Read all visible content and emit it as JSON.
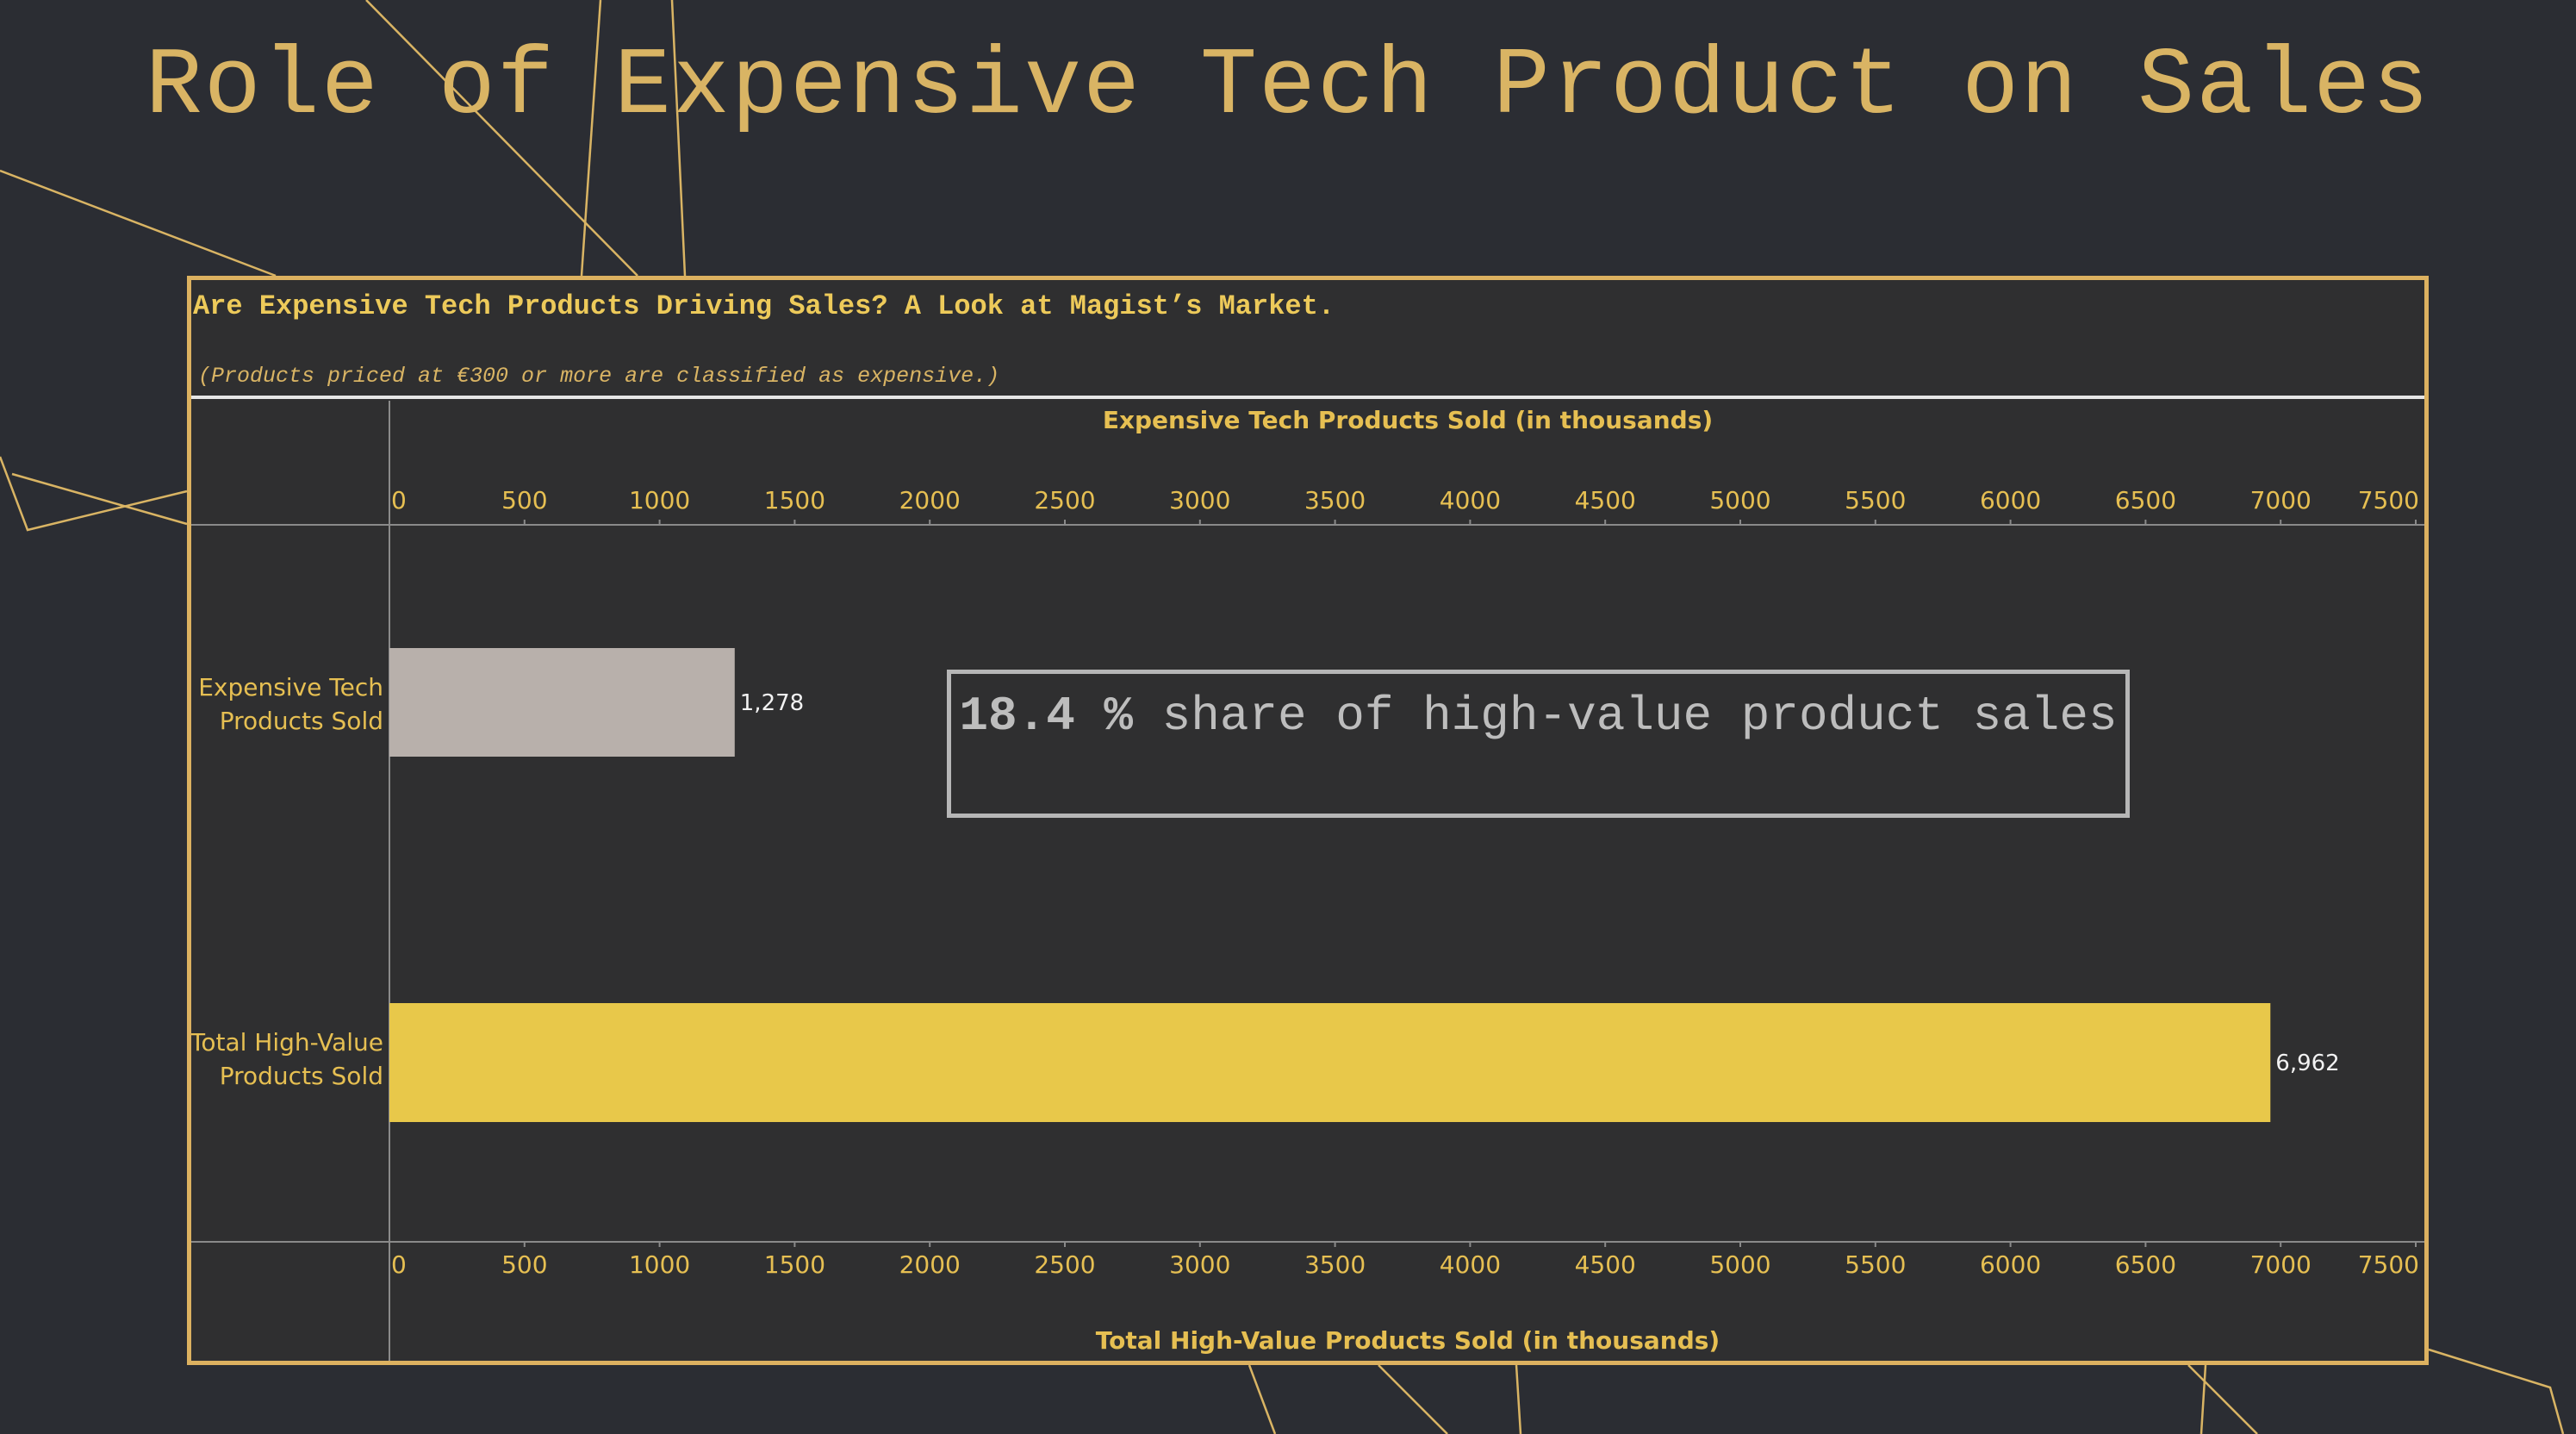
{
  "slide": {
    "title": "Role of Expensive Tech Product on Sales"
  },
  "panel": {
    "heading": "Are Expensive Tech Products Driving Sales? A Look at Magist’s Market.",
    "note": "(Products priced at €300 or more are classified as expensive.)"
  },
  "callout": {
    "value": "18.4 %",
    "text": "share of high-value product sales"
  },
  "colors": {
    "background": "#2b2d33",
    "panel_background": "#2f2f30",
    "accent_gold": "#dcb160",
    "label_gold": "#e6bf52",
    "bar_expensive": "#b8b0ab",
    "bar_total": "#e8c84a"
  },
  "chart_data": {
    "type": "bar",
    "orientation": "horizontal",
    "categories": [
      "Expensive Tech Products Sold",
      "Total High-Value Products Sold"
    ],
    "values": [
      1278,
      6962
    ],
    "value_labels": [
      "1,278",
      "6,962"
    ],
    "top_axis_label": "Expensive Tech Products Sold (in thousands)",
    "bottom_axis_label": "Total High-Value Products Sold (in thousands)",
    "xlim": [
      0,
      7500
    ],
    "ticks": [
      0,
      500,
      1000,
      1500,
      2000,
      2500,
      3000,
      3500,
      4000,
      4500,
      5000,
      5500,
      6000,
      6500,
      7000,
      7500
    ],
    "grid": false
  }
}
